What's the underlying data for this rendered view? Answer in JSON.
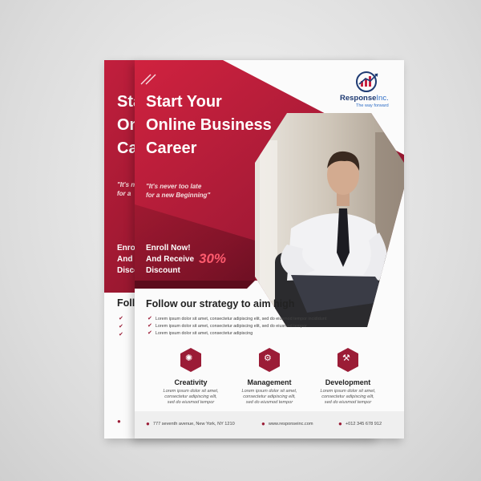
{
  "front": {
    "logo": {
      "name_strong": "Response",
      "name_light": "Inc.",
      "tagline": "The way forward"
    },
    "headline": [
      "Start Your",
      "Online Business",
      "Career"
    ],
    "quote": [
      "\"It's never too late",
      "for a new Beginning\""
    ],
    "enroll": [
      "Enroll Now!",
      "And Receive",
      "Discount"
    ],
    "discount": "30%",
    "strategy_title": "Follow our strategy to aim high",
    "bullets": [
      "Lorem ipsum dolor sit amet, consectetur adipiscing elit, sed do eiusmod tempor incididunt",
      "Lorem ipsum dolor sit amet, consectetur adipiscing elit, sed do eiusmod tempor",
      "Lorem ipsum dolor sit amet, consectetur adipiscing"
    ],
    "services": [
      {
        "title": "Creativity",
        "icon": "lightbulb-icon",
        "desc": [
          "Lorem ipsum dolor sit amet,",
          "consectetur adipiscing elit,",
          "sed do eiusmod tempor"
        ]
      },
      {
        "title": "Management",
        "icon": "management-icon",
        "desc": [
          "Lorem ipsum dolor sit amet,",
          "consectetur adipiscing elit,",
          "sed do eiusmod tempor"
        ]
      },
      {
        "title": "Development",
        "icon": "development-icon",
        "desc": [
          "Lorem ipsum dolor sit amet,",
          "consectetur adipiscing elit,",
          "sed do eiusmod tempor"
        ]
      }
    ],
    "footer": {
      "address": "777 seventh avenue, New York, NY 1210",
      "website": "www.responseinc.com",
      "phone": "+012 345 678 912"
    }
  },
  "back": {
    "headline": [
      "Star",
      "On",
      "Ca"
    ],
    "quote": [
      "\"It's n",
      "for a"
    ],
    "enroll": [
      "Enrol",
      "And",
      "Discou"
    ],
    "strategy_title": "Follo"
  },
  "colors": {
    "primary_red": "#9b1c36",
    "dark_red": "#6e0f22",
    "bright_red": "#c8203f",
    "logo_blue": "#1f3b73"
  }
}
